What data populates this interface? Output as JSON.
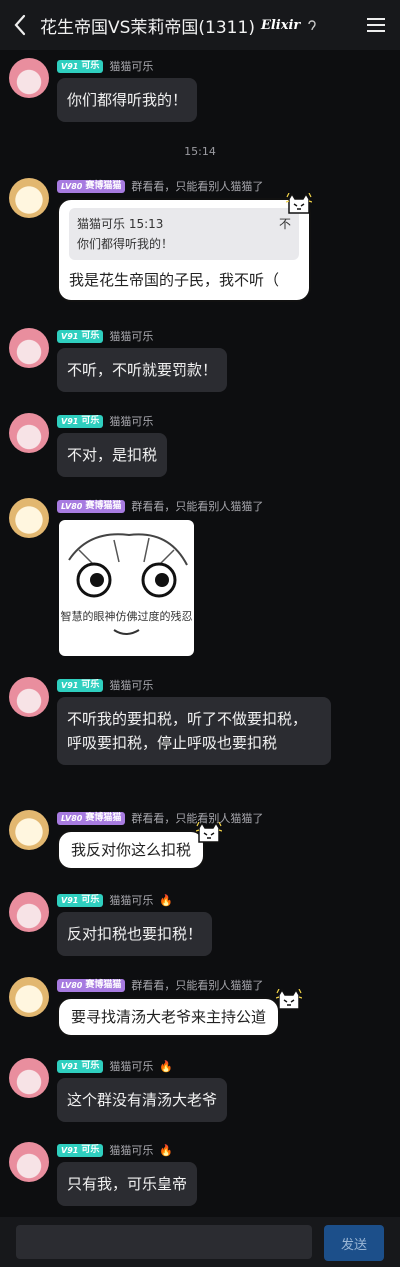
{
  "header": {
    "title": "花生帝国VS茉莉帝国(1311)",
    "brand": "Elixir"
  },
  "users": {
    "kele": {
      "level": "V91",
      "tag": "可乐",
      "nick": "猫猫可乐"
    },
    "cyber": {
      "level": "LV80",
      "tag": "赛博猫猫",
      "nick": "群看看，只能看别人猫猫了"
    }
  },
  "messages": [
    {
      "user": "kele",
      "text": "你们都得听我的！"
    },
    {
      "user": "cyber",
      "quote_header": "猫猫可乐 15:13",
      "quote_close": "不",
      "quote_text": "你们都得听我的！",
      "text": "我是花生帝国的子民，我不听（"
    },
    {
      "user": "kele",
      "text": "不听，不听就要罚款！"
    },
    {
      "user": "kele",
      "text": "不对，是扣税"
    },
    {
      "user": "cyber",
      "sticker_caption": "智慧的眼神仿佛过度的残忍"
    },
    {
      "user": "kele",
      "text": "不听我的要扣税，听了不做要扣税，呼吸要扣税，停止呼吸也要扣税"
    },
    {
      "user": "cyber",
      "text": "我反对你这么扣税"
    },
    {
      "user": "kele",
      "text": "反对扣税也要扣税！"
    },
    {
      "user": "cyber",
      "text": "要寻找清汤大老爷来主持公道"
    },
    {
      "user": "kele",
      "text": "这个群没有清汤大老爷"
    },
    {
      "user": "kele",
      "text": "只有我，可乐皇帝"
    }
  ],
  "timestamp": "15:14",
  "input": {
    "placeholder": "",
    "send_label": "发送"
  },
  "colors": {
    "teal_badge": "#2fcfbf",
    "purple_badge": "#a77be0",
    "send_button": "#1c4f8a"
  }
}
